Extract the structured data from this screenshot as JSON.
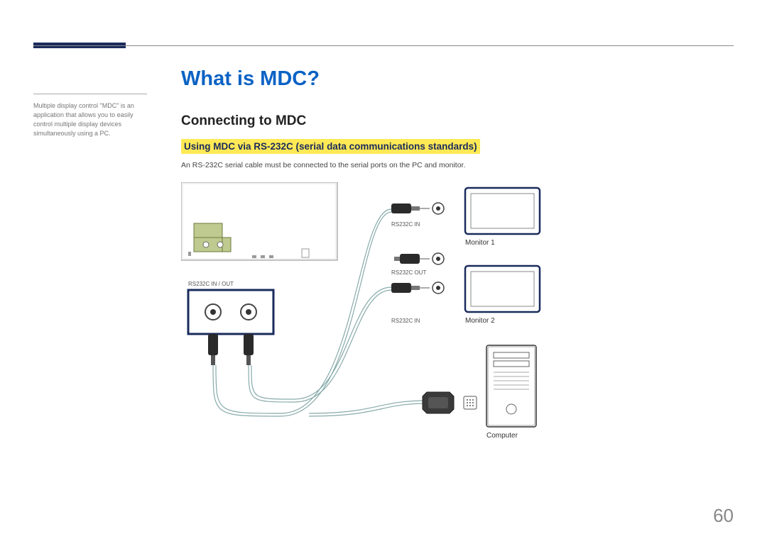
{
  "sidebar": {
    "note": "Multiple display control \"MDC\" is an application that allows you to easily control multiple display devices simultaneously using a PC."
  },
  "main": {
    "title": "What is MDC?",
    "subtitle": "Connecting to MDC",
    "section_heading": "Using MDC via RS-232C (serial data communications standards)",
    "body": "An RS-232C serial cable must be connected to the serial ports on the PC and monitor."
  },
  "diagram": {
    "port_block_label": "RS232C IN / OUT",
    "cable1_label": "RS232C IN",
    "cable2_label_top": "RS232C OUT",
    "cable2_label_bottom": "RS232C IN",
    "monitor1": "Monitor 1",
    "monitor2": "Monitor 2",
    "computer": "Computer"
  },
  "page_number": "60"
}
